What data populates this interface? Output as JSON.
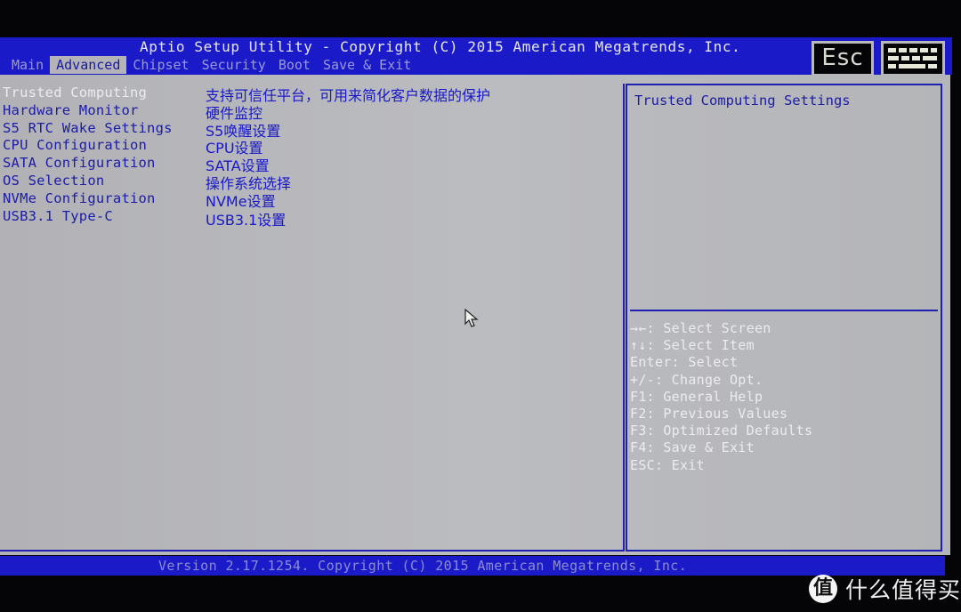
{
  "header": {
    "title": "Aptio Setup Utility - Copyright (C) 2015 American Megatrends, Inc.",
    "tabs": [
      {
        "label": "Main",
        "active": false
      },
      {
        "label": "Advanced",
        "active": true
      },
      {
        "label": "Chipset",
        "active": false
      },
      {
        "label": "Security",
        "active": false
      },
      {
        "label": "Boot",
        "active": false
      },
      {
        "label": "Save & Exit",
        "active": false
      }
    ],
    "esc_label": "Esc",
    "keyboard_icon": "keyboard-icon"
  },
  "menu": {
    "items": [
      {
        "label": "Trusted Computing",
        "desc": "支持可信任平台，可用来简化客户数据的保护",
        "selected": true
      },
      {
        "label": "Hardware Monitor",
        "desc": "硬件监控",
        "selected": false
      },
      {
        "label": "S5 RTC Wake Settings",
        "desc": "S5唤醒设置",
        "selected": false
      },
      {
        "label": "CPU Configuration",
        "desc": "CPU设置",
        "selected": false
      },
      {
        "label": "SATA Configuration",
        "desc": "SATA设置",
        "selected": false
      },
      {
        "label": "OS Selection",
        "desc": "操作系统选择",
        "selected": false
      },
      {
        "label": "NVMe Configuration",
        "desc": "NVMe设置",
        "selected": false
      },
      {
        "label": "USB3.1 Type-C",
        "desc": "USB3.1设置",
        "selected": false
      }
    ]
  },
  "help": {
    "title": "Trusted Computing Settings",
    "keys": [
      "→←: Select Screen",
      "↑↓: Select Item",
      "Enter: Select",
      "+/-: Change Opt.",
      "F1: General Help",
      "F2: Previous Values",
      "F3: Optimized Defaults",
      "F4: Save & Exit",
      "ESC: Exit"
    ]
  },
  "footer": {
    "version": "Version 2.17.1254. Copyright (C) 2015 American Megatrends, Inc."
  },
  "watermark": {
    "logo_char": "值",
    "text": "什么值得买"
  },
  "colors": {
    "bar_blue": "#1a1ac8",
    "panel_gray": "#b6b6ba",
    "text_blue": "#1c1ca4",
    "text_white": "#ececf0"
  }
}
